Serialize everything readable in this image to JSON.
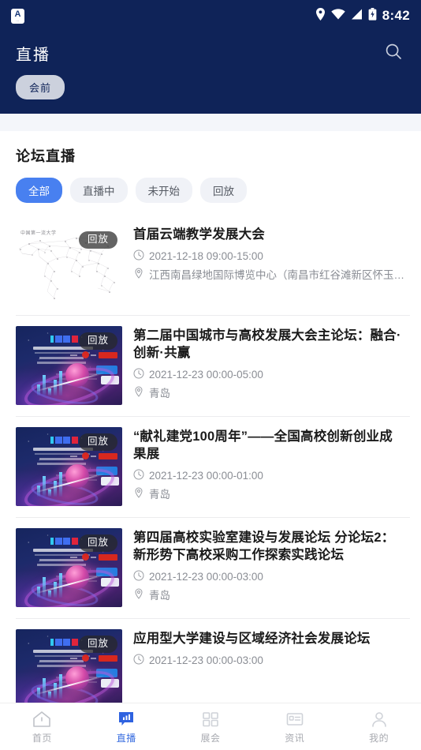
{
  "statusbar": {
    "app_icon": "app-badge-icon",
    "app_icon_letter": "A",
    "app_icon_sub": "···",
    "icons": [
      "location-pin-icon",
      "wifi-icon",
      "signal-icon",
      "battery-charging-icon"
    ],
    "time": "8:42"
  },
  "header": {
    "title": "直播",
    "search_icon": "search-icon",
    "chip_label": "会前",
    "bg_color": "#0f2358"
  },
  "section": {
    "title": "论坛直播",
    "filters": [
      {
        "label": "全部",
        "active": true
      },
      {
        "label": "直播中",
        "active": false
      },
      {
        "label": "未开始",
        "active": false
      },
      {
        "label": "回放",
        "active": false
      }
    ],
    "active_color": "#4880f0"
  },
  "list": [
    {
      "badge": "回放",
      "thumb": "world-map-dots",
      "thumb_caption": "中国第一流大学",
      "title": "首届云端教学发展大会",
      "time": "2021-12-18 09:00-15:00",
      "location": "江西南昌绿地国际博览中心（南昌市红谷滩新区怀玉山…"
    },
    {
      "badge": "回放",
      "thumb": "ieec-banner",
      "title": "第二届中国城市与高校发展大会主论坛：融合·创新·共赢",
      "time": "2021-12-23 00:00-05:00",
      "location": "青岛"
    },
    {
      "badge": "回放",
      "thumb": "ieec-banner",
      "title": "“献礼建党100周年”——全国高校创新创业成果展",
      "time": "2021-12-23 00:00-01:00",
      "location": "青岛"
    },
    {
      "badge": "回放",
      "thumb": "ieec-banner",
      "title": "第四届高校实验室建设与发展论坛 分论坛2：新形势下高校采购工作探索实践论坛",
      "time": "2021-12-23 00:00-03:00",
      "location": "青岛"
    },
    {
      "badge": "回放",
      "thumb": "ieec-banner",
      "title": "应用型大学建设与区域经济社会发展论坛",
      "time": "2021-12-23 00:00-03:00",
      "location": ""
    }
  ],
  "meta_icons": {
    "time": "clock-icon",
    "location": "location-pin-icon"
  },
  "bottomnav": {
    "items": [
      {
        "label": "首页",
        "icon": "home-icon",
        "active": false
      },
      {
        "label": "直播",
        "icon": "live-broadcast-icon",
        "active": true
      },
      {
        "label": "展会",
        "icon": "grid-icon",
        "active": false
      },
      {
        "label": "资讯",
        "icon": "news-card-icon",
        "active": false
      },
      {
        "label": "我的",
        "icon": "person-icon",
        "active": false
      }
    ],
    "active_color": "#3b6fe0",
    "inactive_color": "#a8aab0"
  }
}
